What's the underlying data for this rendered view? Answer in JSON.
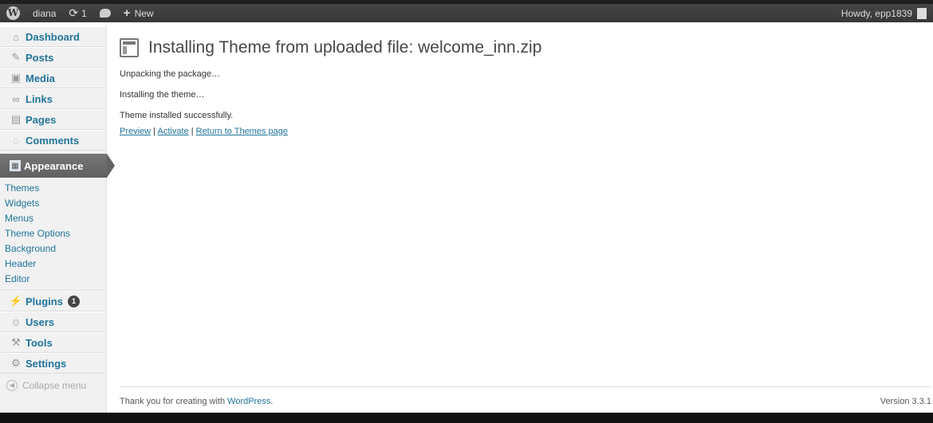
{
  "adminbar": {
    "site_name": "diana",
    "updates_count": "1",
    "new_label": "New",
    "howdy": "Howdy, epp1839"
  },
  "sidebar": {
    "items": [
      {
        "label": "Dashboard",
        "icon": "home-icon"
      },
      {
        "label": "Posts",
        "icon": "pin-icon"
      },
      {
        "label": "Media",
        "icon": "media-icon"
      },
      {
        "label": "Links",
        "icon": "link-icon"
      },
      {
        "label": "Pages",
        "icon": "page-icon"
      },
      {
        "label": "Comments",
        "icon": "comment-icon"
      }
    ],
    "current": {
      "label": "Appearance",
      "icon": "appearance-icon"
    },
    "submenu": [
      "Themes",
      "Widgets",
      "Menus",
      "Theme Options",
      "Background",
      "Header",
      "Editor"
    ],
    "items_after": [
      {
        "label": "Plugins",
        "icon": "plugin-icon",
        "badge": "1"
      },
      {
        "label": "Users",
        "icon": "users-icon"
      },
      {
        "label": "Tools",
        "icon": "tools-icon"
      },
      {
        "label": "Settings",
        "icon": "settings-icon"
      }
    ],
    "collapse_label": "Collapse menu"
  },
  "main": {
    "title": "Installing Theme from uploaded file: welcome_inn.zip",
    "messages": [
      "Unpacking the package…",
      "Installing the theme…",
      "Theme installed successfully."
    ],
    "actions": {
      "preview": "Preview",
      "activate": "Activate",
      "return": "Return to Themes page",
      "separator": " | "
    }
  },
  "footer": {
    "thanks_prefix": "Thank you for creating with",
    "wordpress_link": "WordPress",
    "thanks_suffix": ".",
    "version": "Version 3.3.1"
  },
  "colors": {
    "link": "#21759b",
    "adminbar_bg": "#464646",
    "menu_current_bg": "#6d6d6d"
  }
}
